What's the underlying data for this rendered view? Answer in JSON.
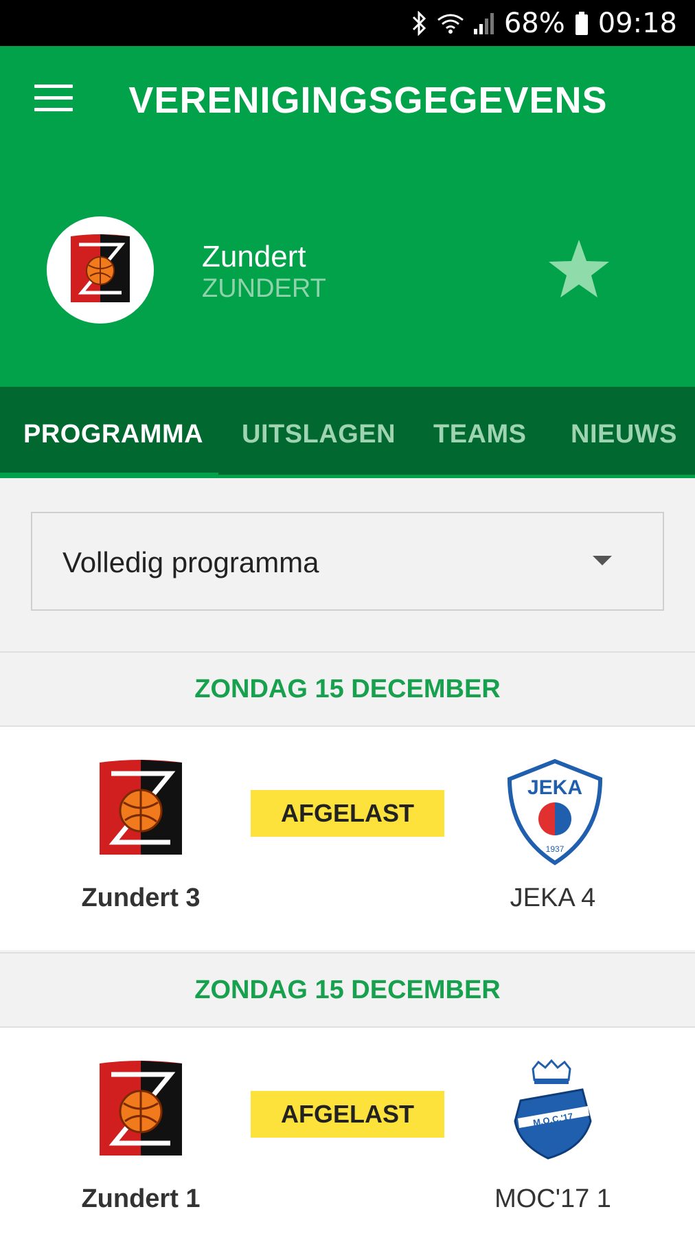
{
  "status_bar": {
    "battery": "68%",
    "time": "09:18"
  },
  "header": {
    "title": "VERENIGINGSGEGEVENS"
  },
  "club": {
    "name": "Zundert",
    "city": "ZUNDERT"
  },
  "tabs": [
    {
      "label": "PROGRAMMA",
      "active": true
    },
    {
      "label": "UITSLAGEN",
      "active": false
    },
    {
      "label": "TEAMS",
      "active": false
    },
    {
      "label": "NIEUWS",
      "active": false
    }
  ],
  "filter": {
    "selected": "Volledig programma"
  },
  "matches": [
    {
      "date": "ZONDAG 15 DECEMBER",
      "home": "Zundert 3",
      "away": "JEKA 4",
      "status": "AFGELAST"
    },
    {
      "date": "ZONDAG 15 DECEMBER",
      "home": "Zundert 1",
      "away": "MOC'17 1",
      "status": "AFGELAST"
    }
  ],
  "logos": {
    "jeka_text": "JEKA",
    "jeka_year": "1937",
    "moc_text": "M.O.C.'17"
  },
  "colors": {
    "primary": "#02a24a",
    "tab_bar": "#01682f",
    "status_tag": "#fde23b",
    "date_text": "#17a04d"
  }
}
